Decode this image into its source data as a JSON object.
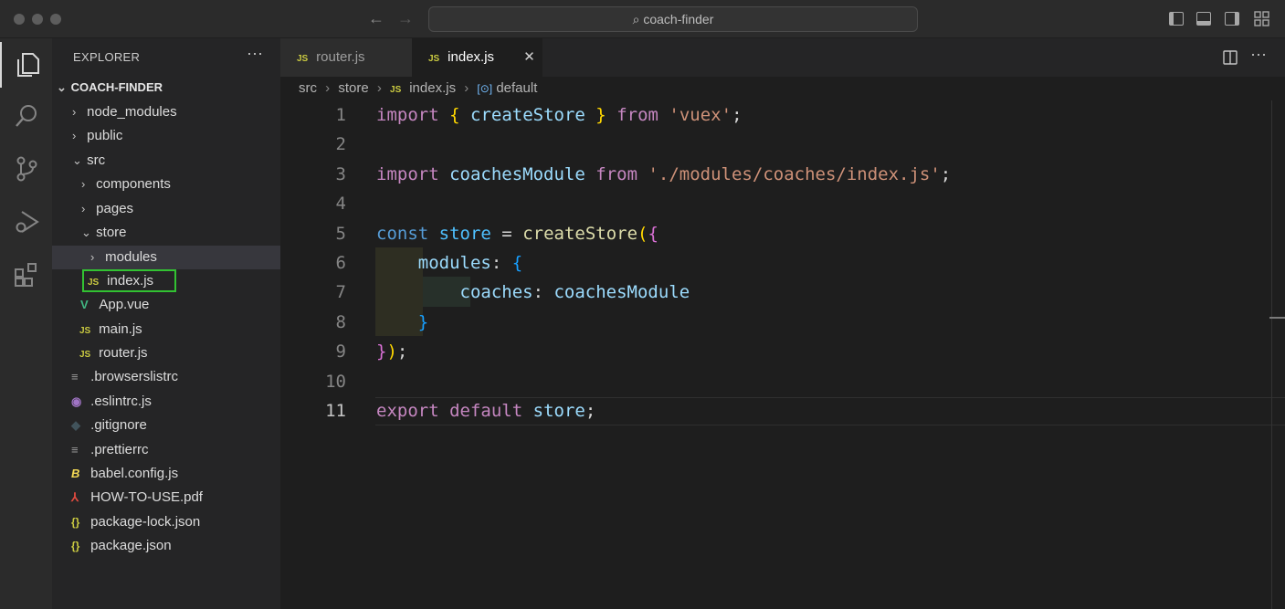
{
  "window": {
    "title": "coach-finder"
  },
  "activity_bar": {
    "items": [
      {
        "name": "explorer",
        "icon": "files-icon"
      },
      {
        "name": "search",
        "icon": "search-icon"
      },
      {
        "name": "source-control",
        "icon": "source-control-icon"
      },
      {
        "name": "run-debug",
        "icon": "run-debug-icon"
      },
      {
        "name": "extensions",
        "icon": "extensions-icon"
      }
    ]
  },
  "sidebar": {
    "header": "EXPLORER",
    "more": "···",
    "folder": "COACH-FINDER",
    "tree": [
      {
        "label": "node_modules",
        "depth": 1,
        "chevron": "›",
        "icon": ""
      },
      {
        "label": "public",
        "depth": 1,
        "chevron": "›",
        "icon": ""
      },
      {
        "label": "src",
        "depth": 1,
        "chevron": "⌄",
        "icon": ""
      },
      {
        "label": "components",
        "depth": 2,
        "chevron": "›",
        "icon": ""
      },
      {
        "label": "pages",
        "depth": 2,
        "chevron": "›",
        "icon": ""
      },
      {
        "label": "store",
        "depth": 2,
        "chevron": "⌄",
        "icon": ""
      },
      {
        "label": "modules",
        "depth": 3,
        "chevron": "›",
        "icon": ""
      },
      {
        "label": "index.js",
        "depth": 3,
        "chevron": "",
        "icon": "JS"
      },
      {
        "label": "App.vue",
        "depth": 2,
        "chevron": "",
        "icon": "V"
      },
      {
        "label": "main.js",
        "depth": 2,
        "chevron": "",
        "icon": "JS"
      },
      {
        "label": "router.js",
        "depth": 2,
        "chevron": "",
        "icon": "JS"
      },
      {
        "label": ".browserslistrc",
        "depth": 1,
        "chevron": "",
        "icon": "≡"
      },
      {
        "label": ".eslintrc.js",
        "depth": 1,
        "chevron": "",
        "icon": "◉"
      },
      {
        "label": ".gitignore",
        "depth": 1,
        "chevron": "",
        "icon": "◆"
      },
      {
        "label": ".prettierrc",
        "depth": 1,
        "chevron": "",
        "icon": "≡"
      },
      {
        "label": "babel.config.js",
        "depth": 1,
        "chevron": "",
        "icon": "B"
      },
      {
        "label": "HOW-TO-USE.pdf",
        "depth": 1,
        "chevron": "",
        "icon": "⅄"
      },
      {
        "label": "package-lock.json",
        "depth": 1,
        "chevron": "",
        "icon": "{}"
      },
      {
        "label": "package.json",
        "depth": 1,
        "chevron": "",
        "icon": "{}"
      }
    ]
  },
  "tabs": [
    {
      "label": "router.js",
      "icon": "JS",
      "active": false
    },
    {
      "label": "index.js",
      "icon": "JS",
      "active": true,
      "close": "✕"
    }
  ],
  "breadcrumb": {
    "items": [
      "src",
      "store",
      "index.js",
      "default"
    ],
    "file_icon": "JS",
    "symbol_icon": "[⊙]"
  },
  "editor": {
    "line_numbers": [
      "1",
      "2",
      "3",
      "4",
      "5",
      "6",
      "7",
      "8",
      "9",
      "10",
      "11"
    ],
    "current_line": "11"
  }
}
